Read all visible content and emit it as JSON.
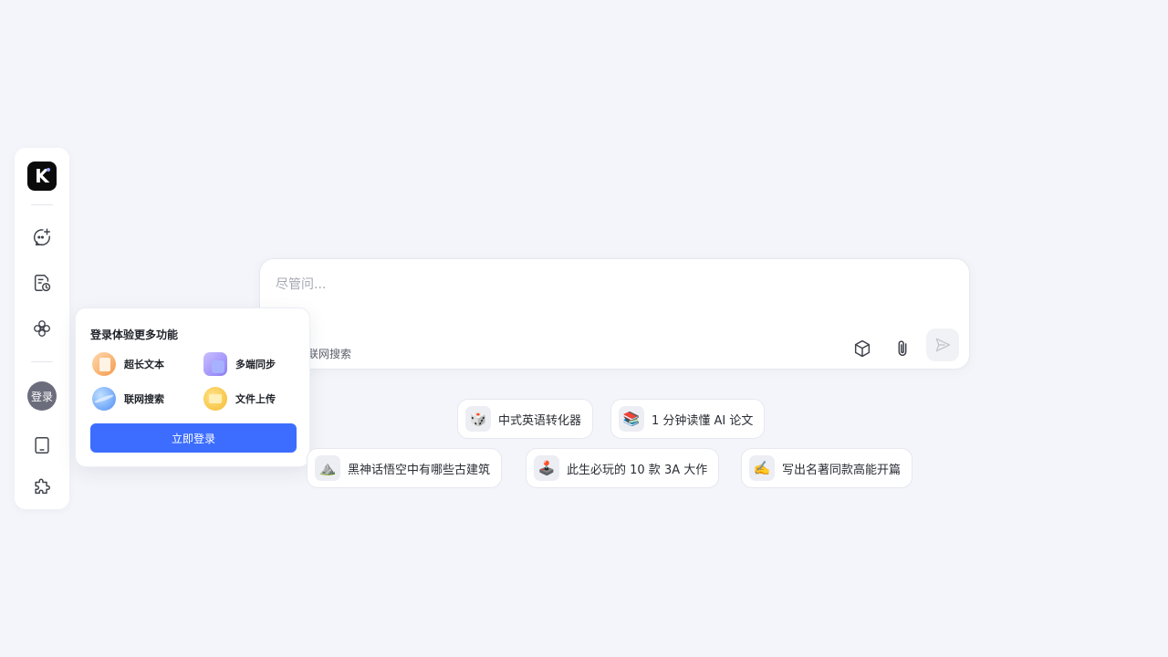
{
  "sidebar": {
    "logo_text": "K",
    "login_label": "登录",
    "icons": [
      "new-chat-icon",
      "history-icon",
      "explore-icon",
      "tablet-icon",
      "plugin-icon"
    ]
  },
  "chat": {
    "placeholder": "尽管问...",
    "web_search_label": "联网搜索"
  },
  "popover": {
    "title": "登录体验更多功能",
    "features": [
      {
        "label": "超长文本",
        "icon": "long-text-icon",
        "color": "#f59a4a"
      },
      {
        "label": "多端同步",
        "icon": "sync-icon",
        "color": "#8b7cf6"
      },
      {
        "label": "联网搜索",
        "icon": "globe-icon",
        "color": "#4e8df5"
      },
      {
        "label": "文件上传",
        "icon": "folder-icon",
        "color": "#f5b82e"
      }
    ],
    "login_button": "立即登录"
  },
  "suggestions": [
    {
      "emoji": "🎲",
      "text": "中式英语转化器"
    },
    {
      "emoji": "📚",
      "text": "1 分钟读懂 AI 论文"
    },
    {
      "emoji": "⛰️",
      "text": "黑神话悟空中有哪些古建筑"
    },
    {
      "emoji": "🕹️",
      "text": "此生必玩的 10 款 3A 大作"
    },
    {
      "emoji": "✍️",
      "text": "写出名著同款高能开篇"
    }
  ],
  "colors": {
    "background": "#f4f5fa",
    "accent": "#3d6dff",
    "avatar": "#6b6d7c"
  }
}
